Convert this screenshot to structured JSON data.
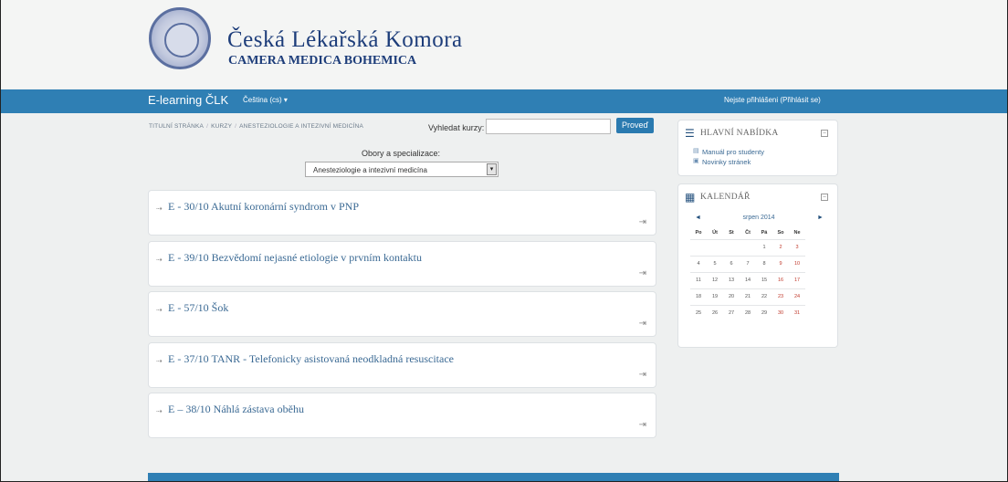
{
  "header": {
    "title": "Česká Lékařská Komora",
    "subtitle": "CAMERA MEDICA BOHEMICA"
  },
  "navbar": {
    "brand": "E-learning ČLK",
    "language": "Čeština (cs) ▾",
    "login": "Nejste přihlášeni (Přihlásit se)"
  },
  "breadcrumb": {
    "items": [
      "TITULNÍ STRÁNKA",
      "KURZY",
      "ANESTEZIOLOGIE A INTEZIVNÍ MEDICÍNA"
    ]
  },
  "search": {
    "label": "Vyhledat kurzy:",
    "value": "",
    "button": "Proveď"
  },
  "filter": {
    "label": "Obory a specializace:",
    "selected": "Anesteziologie a intezivní medicína"
  },
  "courses": [
    {
      "title": "E - 30/10 Akutní koronární syndrom v PNP"
    },
    {
      "title": "E - 39/10 Bezvědomí nejasné etiologie v prvním kontaktu"
    },
    {
      "title": "E - 57/10 Šok"
    },
    {
      "title": "E - 37/10 TANR - Telefonicky asistovaná neodkladná resuscitace"
    },
    {
      "title": "E – 38/10 Náhlá zástava oběhu"
    }
  ],
  "sidebar": {
    "menu": {
      "title": "HLAVNÍ NABÍDKA",
      "items": [
        "Manuál pro studenty",
        "Novinky stránek"
      ]
    },
    "calendar": {
      "title": "KALENDÁŘ",
      "month": "srpen 2014",
      "prev": "◄",
      "next": "►",
      "weekdays": [
        "Po",
        "Út",
        "St",
        "Čt",
        "Pá",
        "So",
        "Ne"
      ],
      "weeks": [
        [
          "",
          "",
          "",
          "",
          "1",
          "2",
          "3"
        ],
        [
          "4",
          "5",
          "6",
          "7",
          "8",
          "9",
          "10"
        ],
        [
          "11",
          "12",
          "13",
          "14",
          "15",
          "16",
          "17"
        ],
        [
          "18",
          "19",
          "20",
          "21",
          "22",
          "23",
          "24"
        ],
        [
          "25",
          "26",
          "27",
          "28",
          "29",
          "30",
          "31"
        ]
      ]
    }
  },
  "colors": {
    "brand_blue": "#2f7fb4",
    "link_blue": "#3b6a94",
    "title_navy": "#1d3d7a",
    "weekend_red": "#c0392b"
  }
}
